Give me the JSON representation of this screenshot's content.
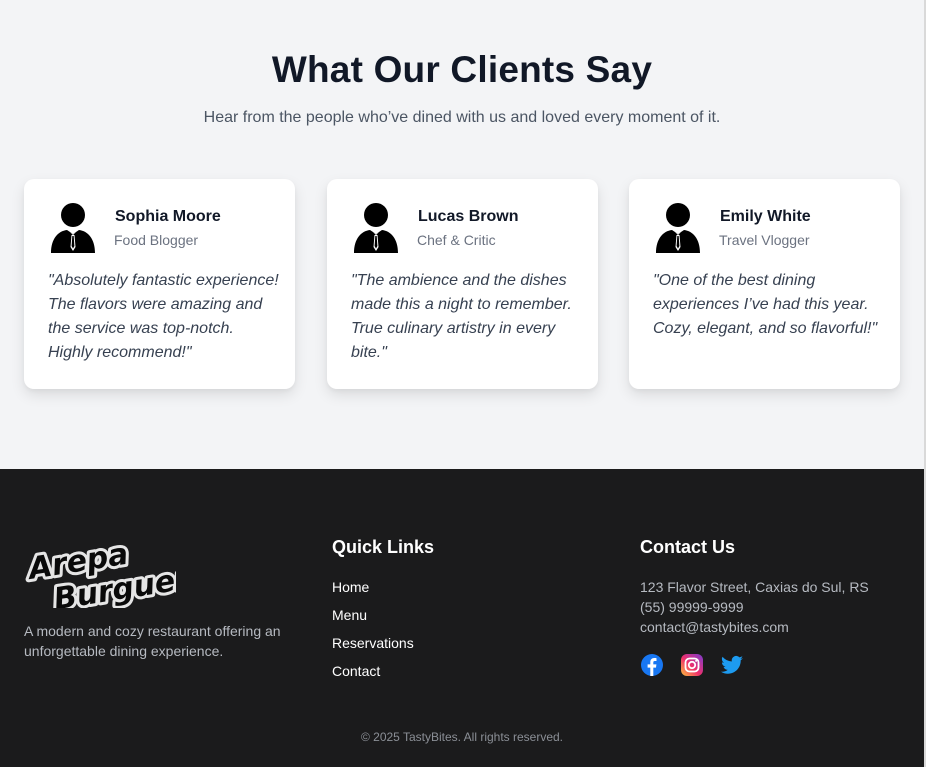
{
  "testimonials": {
    "title": "What Our Clients Say",
    "subtitle": "Hear from the people who’ve dined with us and loved every moment of it.",
    "cards": [
      {
        "name": "Sophia Moore",
        "role": "Food Blogger",
        "quote": "\"Absolutely fantastic experience! The flavors were amazing and the service was top-notch. Highly recommend!\"",
        "avatar_icon": "businessman-avatar-icon"
      },
      {
        "name": "Lucas Brown",
        "role": "Chef & Critic",
        "quote": "\"The ambience and the dishes made this a night to remember. True culinary artistry in every bite.\"",
        "avatar_icon": "businessman-avatar-icon"
      },
      {
        "name": "Emily White",
        "role": "Travel Vlogger",
        "quote": "\"One of the best dining experiences I’ve had this year. Cozy, elegant, and so flavorful!\"",
        "avatar_icon": "businessman-avatar-icon"
      }
    ]
  },
  "footer": {
    "logo_text": "Arepa Burguer",
    "about": "A modern and cozy restaurant offering an unforgettable dining experience.",
    "quick_links": {
      "title": "Quick Links",
      "items": [
        "Home",
        "Menu",
        "Reservations",
        "Contact"
      ]
    },
    "contact": {
      "title": "Contact Us",
      "address": "123 Flavor Street, Caxias do Sul, RS",
      "phone": "(55) 99999-9999",
      "email": "contact@tastybites.com",
      "social": [
        "facebook-icon",
        "instagram-icon",
        "twitter-icon"
      ]
    },
    "copyright": "© 2025 TastyBites. All rights reserved."
  },
  "colors": {
    "page_bg": "#f3f4f6",
    "footer_bg": "#1b1b1c",
    "facebook": "#1877f2",
    "twitter": "#1d9bf0"
  }
}
